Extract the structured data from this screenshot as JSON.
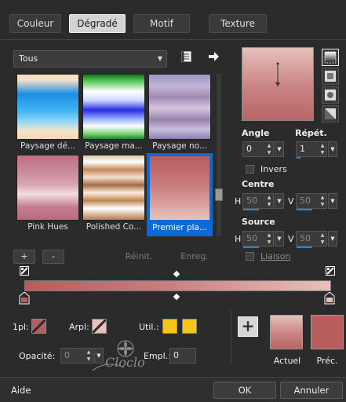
{
  "tabs": [
    {
      "label": "Couleur"
    },
    {
      "label": "Dégradé",
      "active": true
    },
    {
      "label": "Motif"
    },
    {
      "label": "Texture"
    }
  ],
  "category_select": {
    "value": "Tous"
  },
  "gradients": [
    {
      "label": "Paysage dé..."
    },
    {
      "label": "Paysage ma..."
    },
    {
      "label": "Paysage no..."
    },
    {
      "label": "Pink Hues"
    },
    {
      "label": "Polished Co..."
    },
    {
      "label": "Premier pla...",
      "selected": true
    }
  ],
  "library_buttons": {
    "add": "+",
    "remove": "-",
    "reset": "Réinit.",
    "save": "Enreg."
  },
  "angle": {
    "label": "Angle",
    "value": "0"
  },
  "repeat": {
    "label": "Répét.",
    "value": "1"
  },
  "invert": {
    "label": "Invers",
    "checked": false
  },
  "center": {
    "label": "Centre",
    "h_label": "H",
    "h_value": "50",
    "v_label": "V",
    "v_value": "50"
  },
  "source": {
    "label": "Source",
    "h_label": "H",
    "h_value": "50",
    "v_label": "V",
    "v_value": "50"
  },
  "link": {
    "label": "Liaison",
    "checked": false
  },
  "stops": {
    "pos_label": "1pl:",
    "arpl_label": "Arpl:",
    "util_label": "Util.:",
    "opacity_label": "Opacité:",
    "opacity_value": "0",
    "empl_label": "Empl.:",
    "empl_value": "0"
  },
  "color_swatches": {
    "current_label": "Actuel",
    "previous_label": "Préc.",
    "current_color": "#c98382",
    "previous_color": "#b85c5e"
  },
  "colors": {
    "gradient_start": "#b85c5e",
    "gradient_mid": "#c97c7b",
    "gradient_end": "#e8c0bb",
    "util_yellow": "#f5c518",
    "accent_blue": "#0a6bd8"
  },
  "watermark": "Cloclo",
  "footer": {
    "help": "Aide",
    "ok": "OK",
    "cancel": "Annuler"
  }
}
